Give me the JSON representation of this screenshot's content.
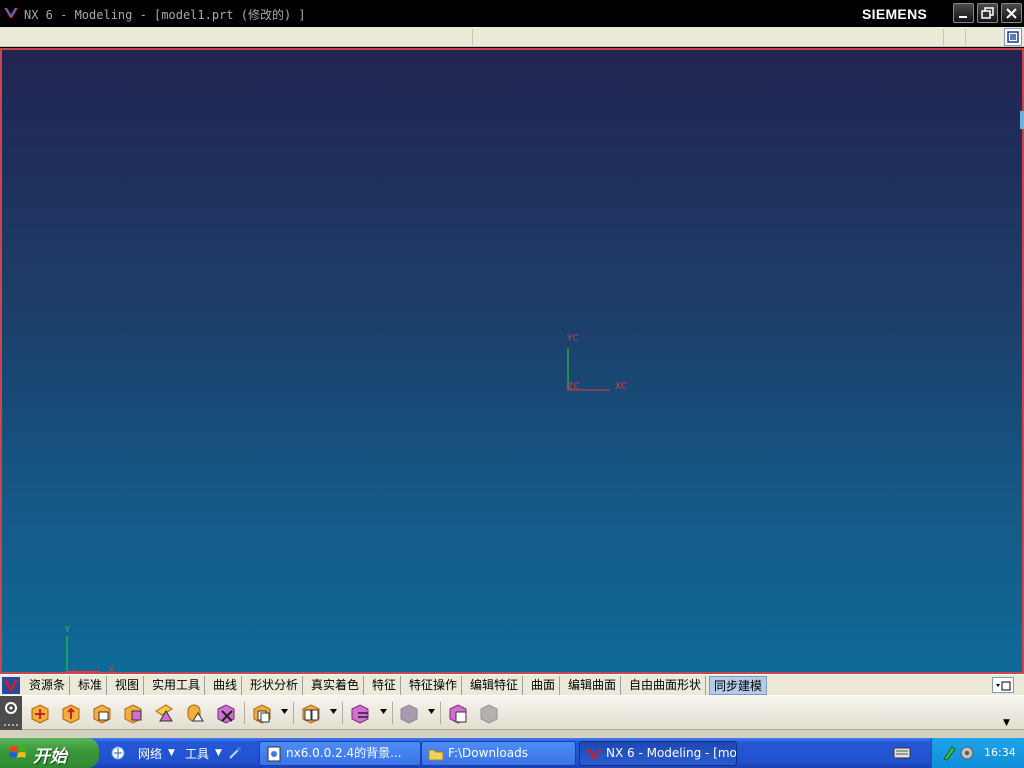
{
  "window": {
    "title": "NX 6 - Modeling - [model1.prt (修改的) ]",
    "brand": "SIEMENS"
  },
  "viewport": {
    "wcs_labels": {
      "y": "YC",
      "z": "ZC",
      "x": "XC"
    },
    "triad_labels": {
      "y": "Y",
      "x": "X"
    },
    "colors": {
      "top": "#222451",
      "bottom": "#0f6a98",
      "border": "#c9464f"
    }
  },
  "tabs": [
    {
      "label": "资源条"
    },
    {
      "label": "标准"
    },
    {
      "label": "视图"
    },
    {
      "label": "实用工具"
    },
    {
      "label": "曲线"
    },
    {
      "label": "形状分析"
    },
    {
      "label": "真实着色"
    },
    {
      "label": "特征"
    },
    {
      "label": "特征操作"
    },
    {
      "label": "编辑特征"
    },
    {
      "label": "曲面"
    },
    {
      "label": "编辑曲面"
    },
    {
      "label": "自由曲面形状"
    },
    {
      "label": "同步建模"
    }
  ],
  "active_tab": "同步建模",
  "toolbar_icons": [
    "move-face-icon",
    "pull-face-icon",
    "offset-region-icon",
    "replace-face-icon",
    "resize-blend-icon",
    "resize-face-icon",
    "delete-face-icon",
    "copy-face-icon",
    "cut-face-icon",
    "paste-face-icon",
    "reuse-icon",
    "group-face-icon"
  ],
  "taskbar": {
    "start_label": "开始",
    "quick_launch": [
      {
        "label": "网络"
      },
      {
        "label": "工具"
      }
    ],
    "tasks": [
      {
        "label": "nx6.0.0.2.4的背景...",
        "active": false
      },
      {
        "label": "F:\\Downloads",
        "active": false
      },
      {
        "label": "NX 6 - Modeling - [mo...",
        "active": true
      }
    ],
    "clock": "16:34"
  }
}
